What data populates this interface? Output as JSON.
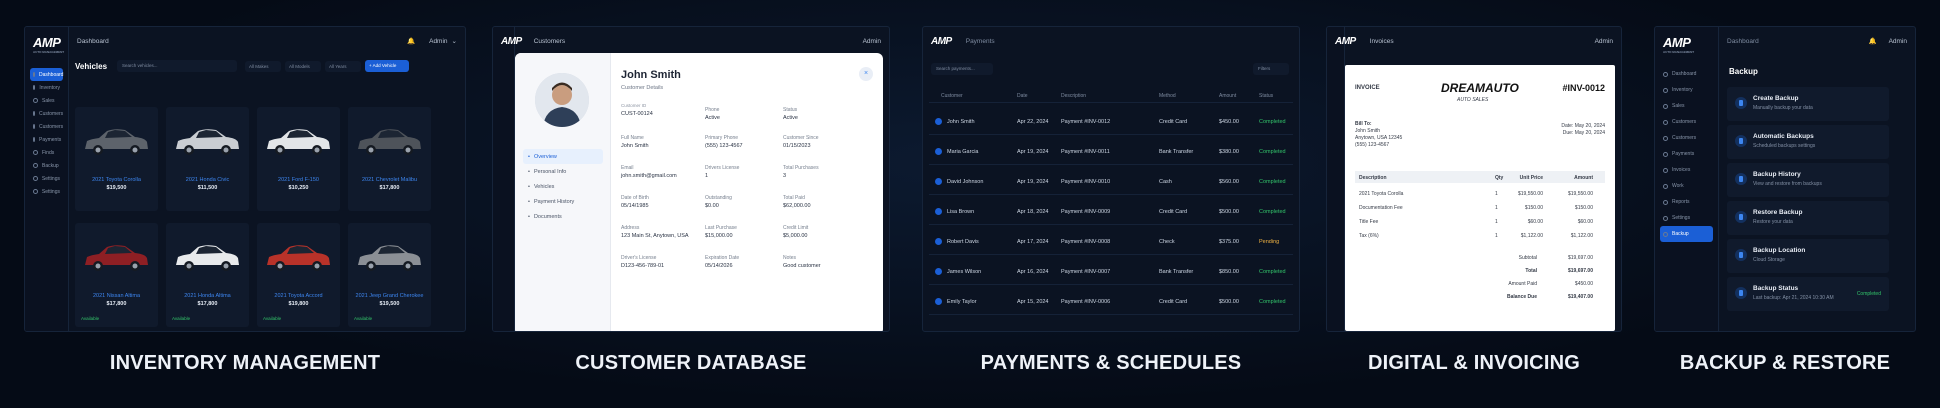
{
  "captions": [
    "INVENTORY MANAGEMENT",
    "CUSTOMER DATABASE",
    "PAYMENTS & SCHEDULES",
    "DIGITAL & INVOICING",
    "BACKUP & RESTORE"
  ],
  "brand": {
    "logo": "AMP",
    "logo_sub": "AUTO MANAGEMENT"
  },
  "inventory": {
    "title": "Dashboard",
    "user": "Admin",
    "menu": [
      "Dashboard",
      "Inventory",
      "Sales",
      "Customers",
      "Customers",
      "Payments",
      "Finds",
      "Backup",
      "Settings",
      "Settings"
    ],
    "section": "Vehicles",
    "search_placeholder": "Search vehicles...",
    "filters": [
      "All Makes",
      "All Models",
      "All Years"
    ],
    "add_label": "+ Add Vehicle",
    "cars": [
      {
        "name": "2021 Toyota Corolla",
        "price": "$19,500",
        "color": "#5d636b"
      },
      {
        "name": "2021 Honda Civic",
        "price": "$11,500",
        "color": "#c9cdd2"
      },
      {
        "name": "2021 Ford F-150",
        "price": "$10,250",
        "color": "#e2e5e8"
      },
      {
        "name": "2021 Chevrolet Malibu",
        "price": "$17,800",
        "color": "#4e535a"
      },
      {
        "name": "2021 Nissan Altima",
        "price": "$17,800",
        "color": "#8e1f24"
      },
      {
        "name": "2021 Honda Altima",
        "price": "$17,800",
        "color": "#e8eaec"
      },
      {
        "name": "2021 Toyota Accord",
        "price": "$19,800",
        "color": "#b83229"
      },
      {
        "name": "2021 Jeep Grand Cherokee",
        "price": "$19,500",
        "color": "#8b8f95"
      }
    ],
    "status": "Available"
  },
  "customer": {
    "title": "Customers",
    "name": "John Smith",
    "subtitle": "Customer Details",
    "id_label": "Customer ID",
    "id_value": "CUST-00124",
    "tabs": [
      "Overview",
      "Personal Info",
      "Vehicles",
      "Payment History",
      "Documents"
    ],
    "fields": [
      {
        "label": "Phone",
        "value": "Active"
      },
      {
        "label": "Status",
        "value": "Active"
      },
      {
        "label": "Full Name",
        "value": "John Smith"
      },
      {
        "label": "Primary Phone",
        "value": "(555) 123-4567"
      },
      {
        "label": "Customer Since",
        "value": "01/15/2023"
      },
      {
        "label": "Email",
        "value": "john.smith@gmail.com"
      },
      {
        "label": "Drivers License",
        "value": "1"
      },
      {
        "label": "Total Purchases",
        "value": "3"
      },
      {
        "label": "Date of Birth",
        "value": "05/14/1985"
      },
      {
        "label": "Outstanding",
        "value": "$0.00"
      },
      {
        "label": "Total Paid",
        "value": "$62,000.00"
      },
      {
        "label": "Address",
        "value": "123 Main St, Anytown, USA"
      },
      {
        "label": "Last Purchase",
        "value": "$15,000.00"
      },
      {
        "label": "Credit Limit",
        "value": "$5,000.00"
      },
      {
        "label": "Driver's License",
        "value": "D123-456-789-01"
      },
      {
        "label": "Expiration Date",
        "value": "05/14/2026"
      },
      {
        "label": "Notes",
        "value": "Good customer"
      }
    ]
  },
  "payments": {
    "title": "Payments",
    "search_placeholder": "Search payments...",
    "filter_label": "Filters",
    "headers": [
      "Customer",
      "Date",
      "Description",
      "Method",
      "Amount",
      "Status"
    ],
    "rows": [
      {
        "customer": "John Smith",
        "date": "Apr 22, 2024",
        "desc": "Payment #INV-0012",
        "method": "Credit Card",
        "amount": "$450.00",
        "status": "Completed"
      },
      {
        "customer": "Maria Garcia",
        "date": "Apr 19, 2024",
        "desc": "Payment #INV-0011",
        "method": "Bank Transfer",
        "amount": "$380.00",
        "status": "Completed"
      },
      {
        "customer": "David Johnson",
        "date": "Apr 19, 2024",
        "desc": "Payment #INV-0010",
        "method": "Cash",
        "amount": "$560.00",
        "status": "Completed"
      },
      {
        "customer": "Lisa Brown",
        "date": "Apr 18, 2024",
        "desc": "Payment #INV-0009",
        "method": "Credit Card",
        "amount": "$500.00",
        "status": "Completed"
      },
      {
        "customer": "Robert Davis",
        "date": "Apr 17, 2024",
        "desc": "Payment #INV-0008",
        "method": "Check",
        "amount": "$375.00",
        "status": "Pending"
      },
      {
        "customer": "James Wilson",
        "date": "Apr 16, 2024",
        "desc": "Payment #INV-0007",
        "method": "Bank Transfer",
        "amount": "$850.00",
        "status": "Completed"
      },
      {
        "customer": "Emily Taylor",
        "date": "Apr 15, 2024",
        "desc": "Payment #INV-0006",
        "method": "Credit Card",
        "amount": "$500.00",
        "status": "Completed"
      }
    ]
  },
  "invoice": {
    "title": "Invoices",
    "user": "Admin",
    "doc_label": "INVOICE",
    "brand": "DREAMAUTO",
    "brand_sub": "AUTO SALES",
    "number": "#INV-0012",
    "bill_to": [
      "Bill To:",
      "John Smith",
      "Anytown, USA 12345",
      "(555) 123-4567"
    ],
    "dates": [
      "Date: May 20, 2024",
      "Due: May 20, 2024"
    ],
    "headers": [
      "Description",
      "Qty",
      "Unit Price",
      "Amount"
    ],
    "items": [
      {
        "desc": "2021 Toyota Corolla",
        "qty": "1",
        "unit": "$19,550.00",
        "amount": "$19,550.00"
      },
      {
        "desc": "Documentation Fee",
        "qty": "1",
        "unit": "$150.00",
        "amount": "$150.00"
      },
      {
        "desc": "Title Fee",
        "qty": "1",
        "unit": "$60.00",
        "amount": "$60.00"
      },
      {
        "desc": "Tax (6%)",
        "qty": "1",
        "unit": "$1,122.00",
        "amount": "$1,122.00"
      }
    ],
    "totals": [
      {
        "label": "Subtotal",
        "value": "$19,697.00"
      },
      {
        "label": "Total",
        "value": "$19,697.00"
      },
      {
        "label": "Amount Paid",
        "value": "$450.00"
      },
      {
        "label": "Balance Due",
        "value": "$19,407.00"
      }
    ]
  },
  "backup": {
    "title": "Dashboard",
    "user": "Admin",
    "menu": [
      "Dashboard",
      "Inventory",
      "Sales",
      "Customers",
      "Customers",
      "Payments",
      "Invoices",
      "Work",
      "Reports",
      "Settings",
      "Backup"
    ],
    "section": "Backup",
    "cards": [
      {
        "title": "Create Backup",
        "desc": "Manually backup your data"
      },
      {
        "title": "Automatic Backups",
        "desc": "Scheduled backups settings"
      },
      {
        "title": "Backup History",
        "desc": "View and restore from backups"
      },
      {
        "title": "Restore Backup",
        "desc": "Restore your data"
      },
      {
        "title": "Backup Location",
        "desc": "Cloud Storage"
      },
      {
        "title": "Backup Status",
        "desc": "Last backup: Apr 21, 2024 10:30 AM"
      }
    ],
    "status_value": "Completed"
  }
}
